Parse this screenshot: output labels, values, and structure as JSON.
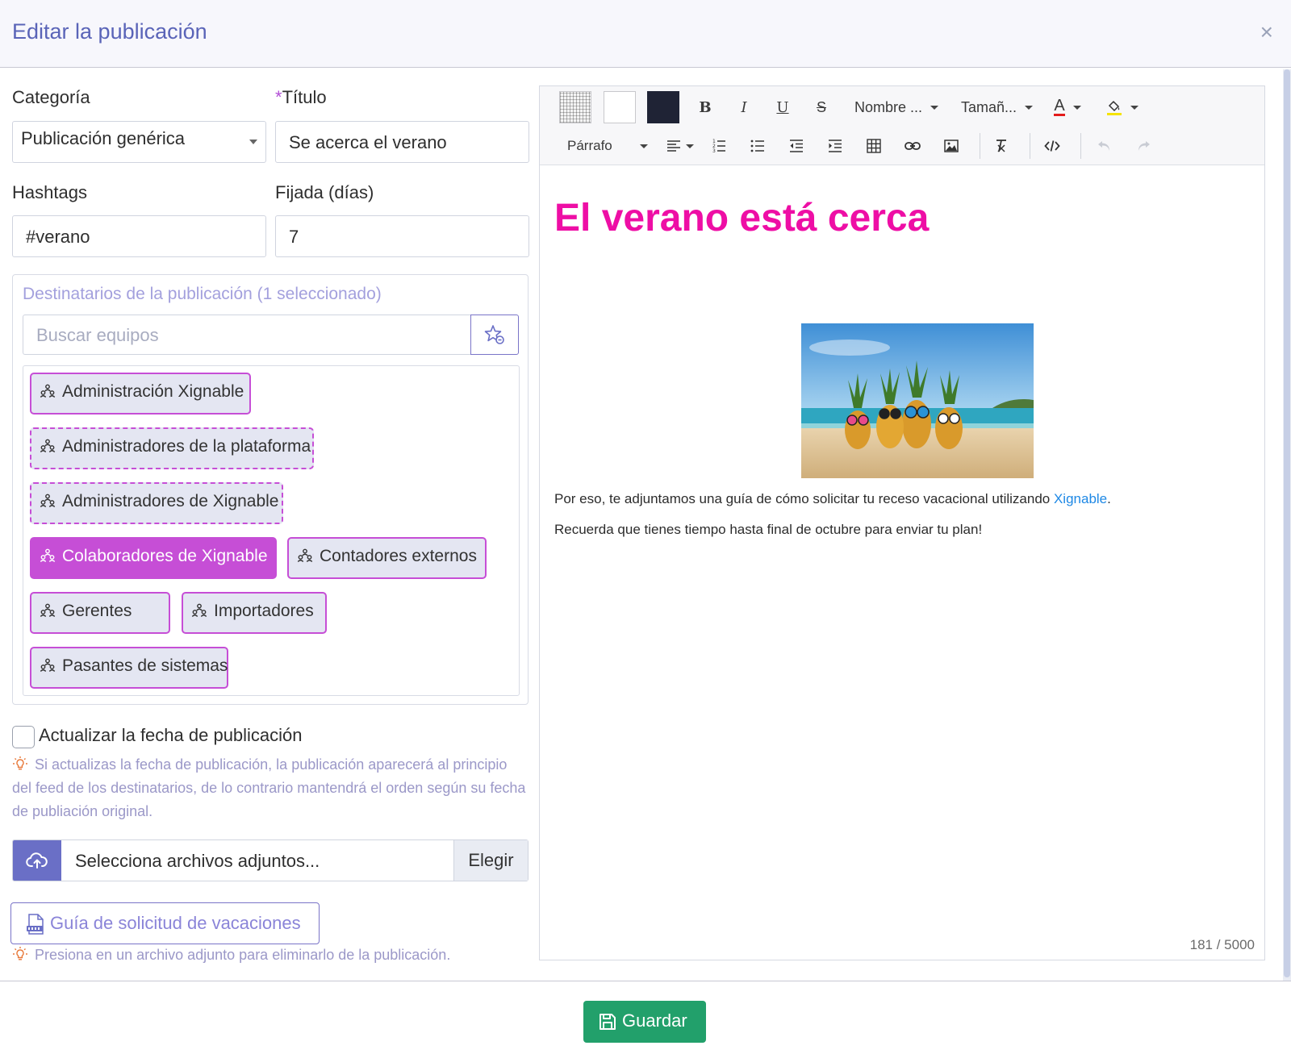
{
  "modal": {
    "title": "Editar la publicación",
    "close_label": "×"
  },
  "form": {
    "category_label": "Categoría",
    "category_value": "Publicación genérica",
    "title_required_mark": "*",
    "title_label": "Título",
    "title_value": "Se acerca el verano",
    "hashtags_label": "Hashtags",
    "hashtags_value": "#verano",
    "pinned_label": "Fijada (días)",
    "pinned_value": "7"
  },
  "recipients": {
    "title": "Destinatarios de la publicación (1 seleccionado)",
    "search_placeholder": "Buscar equipos",
    "teams": [
      {
        "label": "Administración Xignable",
        "style": "solid",
        "selected": false
      },
      {
        "label": "Administradores de la plataforma",
        "style": "dashed",
        "selected": false
      },
      {
        "label": "Administradores de Xignable",
        "style": "dashed",
        "selected": false
      },
      {
        "label": "Colaboradores de Xignable",
        "style": "dashed",
        "selected": true
      },
      {
        "label": "Contadores externos",
        "style": "solid",
        "selected": false
      },
      {
        "label": "Gerentes",
        "style": "solid",
        "selected": false
      },
      {
        "label": "Importadores",
        "style": "solid",
        "selected": false
      },
      {
        "label": "Pasantes de sistemas",
        "style": "solid",
        "selected": false
      }
    ]
  },
  "update_date": {
    "label": "Actualizar la fecha de publicación",
    "checked": false,
    "hint": "Si actualizas la fecha de publicación, la publicación aparecerá al principio del feed de los destinatarios, de lo contrario mantendrá el orden según su fecha de publiación original."
  },
  "attachments": {
    "placeholder": "Selecciona archivos adjuntos...",
    "choose_label": "Elegir",
    "files": [
      {
        "name": "Guía de solicitud de vacaciones",
        "icon": "docx-file-icon"
      }
    ],
    "hint": "Presiona en un archivo adjunto para eliminarlo de la publicación."
  },
  "editor": {
    "toolbar": {
      "font_name": "Nombre ...",
      "font_size": "Tamañ...",
      "paragraph": "Párrafo",
      "bold": "B",
      "italic": "I",
      "underline": "U",
      "strike": "S",
      "text_color_glyph": "A"
    },
    "content": {
      "heading": "El verano está cerca",
      "paragraph1_text": "Por eso, te adjuntamos una guía de cómo solicitar tu receso vacacional utilizando ",
      "paragraph1_link": "Xignable",
      "paragraph1_end": ".",
      "paragraph2": "Recuerda que tienes tiempo hasta final de octubre para enviar tu plan!"
    },
    "char_count": "181 / 5000"
  },
  "footer": {
    "save_label": "Guardar"
  },
  "colors": {
    "accent": "#6a6fc6",
    "chip_border": "#c64ed6",
    "heading": "#ee0ea5",
    "save": "#22a06b",
    "link": "#1e88e5"
  }
}
